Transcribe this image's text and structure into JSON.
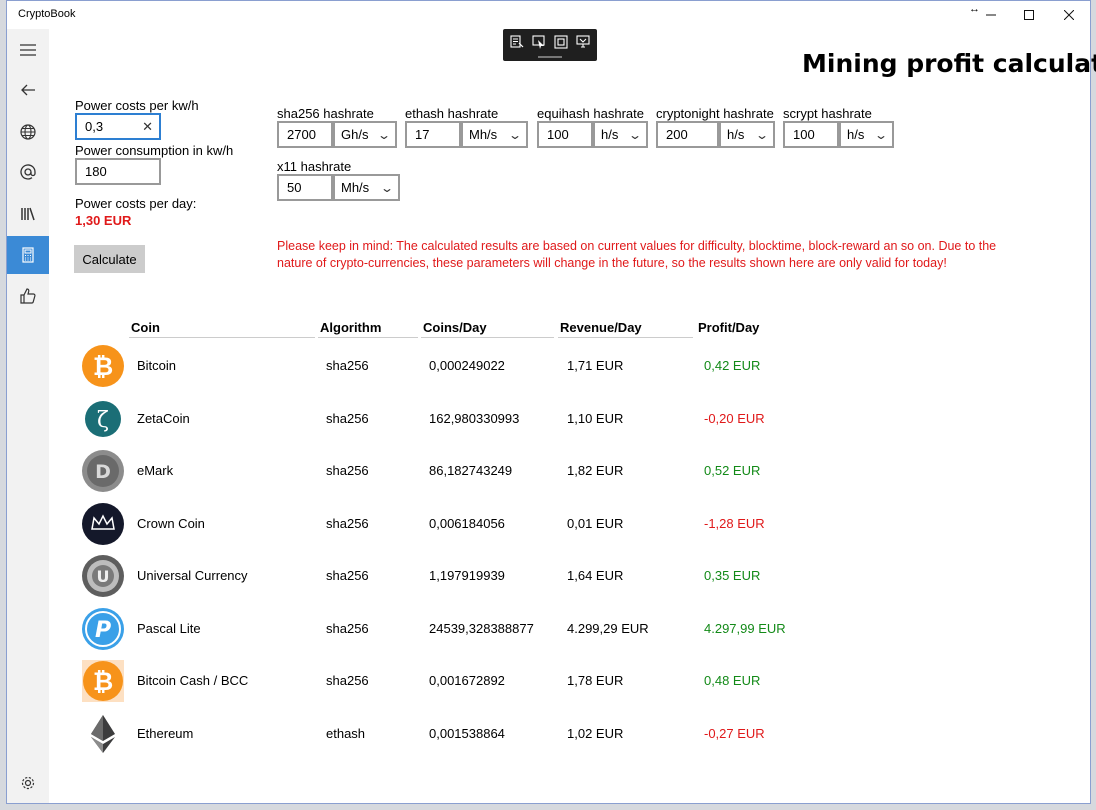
{
  "window": {
    "title": "CryptoBook"
  },
  "page": {
    "title": "Mining profit calculator"
  },
  "power": {
    "cost_label": "Power costs per kw/h",
    "cost_value": "0,3",
    "consumption_label": "Power consumption in kw/h",
    "consumption_value": "180",
    "day_label": "Power costs per day:",
    "day_value": "1,30 EUR"
  },
  "calculate_label": "Calculate",
  "hashrates": [
    {
      "label": "sha256 hashrate",
      "value": "2700",
      "unit": "Gh/s"
    },
    {
      "label": "ethash hashrate",
      "value": "17",
      "unit": "Mh/s"
    },
    {
      "label": "equihash hashrate",
      "value": "100",
      "unit": "h/s"
    },
    {
      "label": "cryptonight hashrate",
      "value": "200",
      "unit": "h/s"
    },
    {
      "label": "scrypt hashrate",
      "value": "100",
      "unit": "h/s"
    },
    {
      "label": "x11 hashrate",
      "value": "50",
      "unit": "Mh/s"
    }
  ],
  "warning": "Please keep in mind: The calculated results are based on current values for difficulty, blocktime, block-reward an so on. Due to the nature of crypto-currencies, these parameters will change in the future, so the results shown here are only valid for today!",
  "table": {
    "headers": [
      "Coin",
      "Algorithm",
      "Coins/Day",
      "Revenue/Day",
      "Profit/Day"
    ],
    "rows": [
      {
        "coin": "Bitcoin",
        "algorithm": "sha256",
        "coins_day": "0,000249022",
        "revenue": "1,71 EUR",
        "profit": "0,42 EUR",
        "icon": "bitcoin-icon"
      },
      {
        "coin": "ZetaCoin",
        "algorithm": "sha256",
        "coins_day": "162,980330993",
        "revenue": "1,10 EUR",
        "profit": "-0,20 EUR",
        "icon": "zetacoin-icon"
      },
      {
        "coin": "eMark",
        "algorithm": "sha256",
        "coins_day": "86,182743249",
        "revenue": "1,82 EUR",
        "profit": "0,52 EUR",
        "icon": "emark-icon"
      },
      {
        "coin": "Crown Coin",
        "algorithm": "sha256",
        "coins_day": "0,006184056",
        "revenue": "0,01 EUR",
        "profit": "-1,28 EUR",
        "icon": "crown-icon"
      },
      {
        "coin": "Universal Currency",
        "algorithm": "sha256",
        "coins_day": "1,197919939",
        "revenue": "1,64 EUR",
        "profit": "0,35 EUR",
        "icon": "universal-currency-icon"
      },
      {
        "coin": "Pascal Lite",
        "algorithm": "sha256",
        "coins_day": "24539,328388877",
        "revenue": "4.299,29 EUR",
        "profit": "4.297,99 EUR",
        "icon": "pascal-lite-icon"
      },
      {
        "coin": "Bitcoin Cash / BCC",
        "algorithm": "sha256",
        "coins_day": "0,001672892",
        "revenue": "1,78 EUR",
        "profit": "0,48 EUR",
        "icon": "bitcoin-cash-icon"
      },
      {
        "coin": "Ethereum",
        "algorithm": "ethash",
        "coins_day": "0,001538864",
        "revenue": "1,02 EUR",
        "profit": "-0,27 EUR",
        "icon": "ethereum-icon"
      }
    ]
  },
  "colors": {
    "accent": "#3b8ad6",
    "negative": "#e0191a",
    "positive": "#138a18"
  }
}
